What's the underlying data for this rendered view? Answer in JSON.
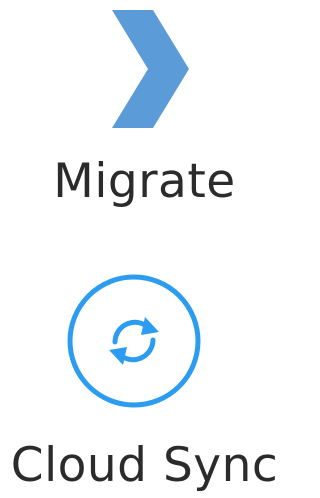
{
  "items": [
    {
      "label": "Migrate",
      "icon": "chevron-right-icon",
      "color": "#5b9bd8"
    },
    {
      "label": "Cloud Sync",
      "icon": "sync-icon",
      "color": "#2c9cf0"
    }
  ]
}
